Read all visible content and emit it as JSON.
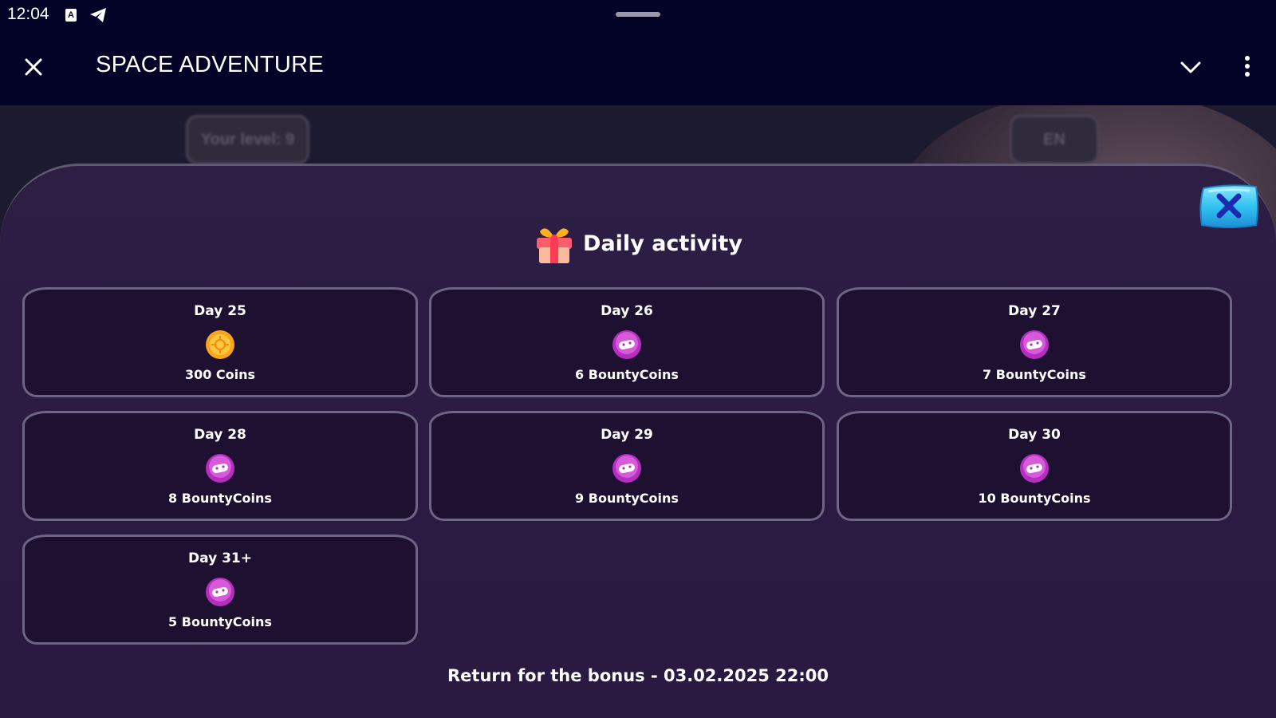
{
  "status_bar": {
    "time": "12:04",
    "keyboard_icon_letter": "A",
    "icons": [
      "keyboard-a-icon",
      "telegram-icon"
    ]
  },
  "app_bar": {
    "title": "SPACE ADVENTURE",
    "icons": [
      "close-icon",
      "chevron-down-icon",
      "more-vert-icon"
    ]
  },
  "background": {
    "level_label": "Your level: 9",
    "lang_label": "EN"
  },
  "modal": {
    "title": "Daily activity",
    "title_icon": "gift-icon",
    "close_icon": "close-icon",
    "days": [
      {
        "day": "Day 25",
        "reward": "300 Coins",
        "icon": "gold-coin-icon"
      },
      {
        "day": "Day 26",
        "reward": "6 BountyCoins",
        "icon": "bounty-coin-icon"
      },
      {
        "day": "Day 27",
        "reward": "7 BountyCoins",
        "icon": "bounty-coin-icon"
      },
      {
        "day": "Day 28",
        "reward": "8 BountyCoins",
        "icon": "bounty-coin-icon"
      },
      {
        "day": "Day 29",
        "reward": "9 BountyCoins",
        "icon": "bounty-coin-icon"
      },
      {
        "day": "Day 30",
        "reward": "10 BountyCoins",
        "icon": "bounty-coin-icon"
      },
      {
        "day": "Day 31+",
        "reward": "5 BountyCoins",
        "icon": "bounty-coin-icon"
      }
    ],
    "footer": "Return for the bonus - 03.02.2025 22:00"
  },
  "colors": {
    "app_bar": "#020326",
    "sheet": "#2b1a42",
    "card_bg": "#1e1030",
    "card_border": "#6c6584",
    "bounty_coin": "#c239c9",
    "gold_coin": "#f7a51c",
    "close_button": "#35c8f2"
  }
}
